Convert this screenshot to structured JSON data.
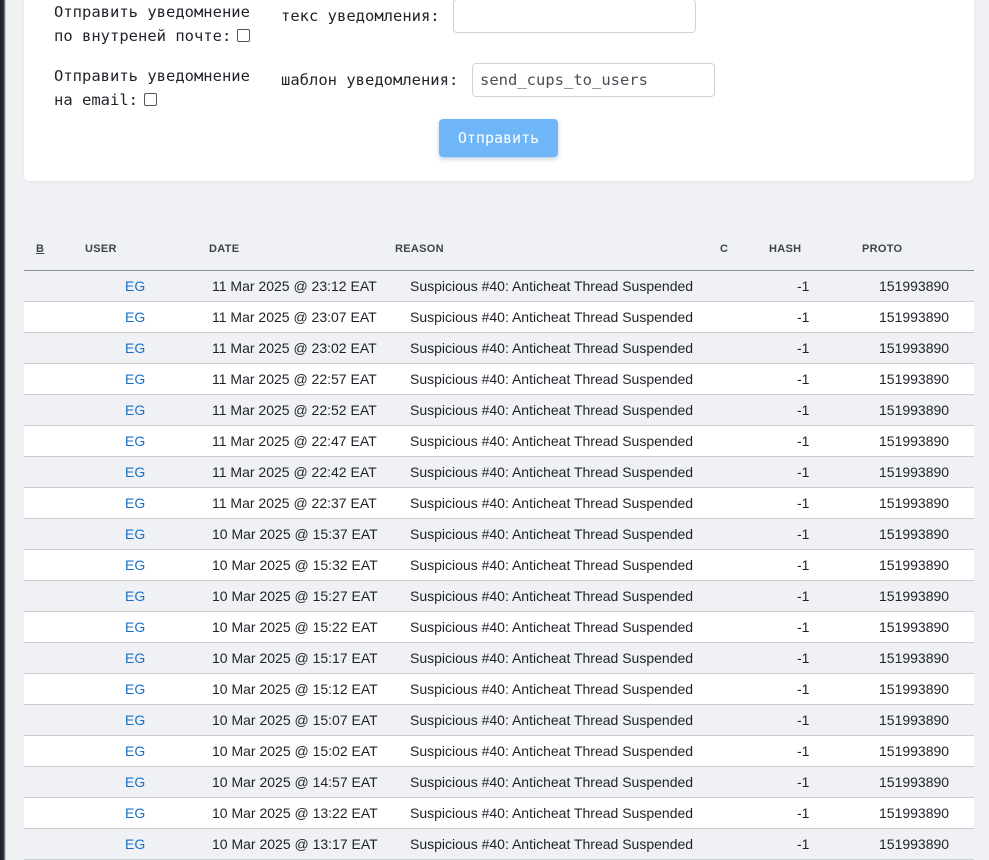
{
  "form": {
    "internal_mail_label_line1": "Отправить уведомнение",
    "internal_mail_label_line2": "по внутреней почте:",
    "email_label_line1": "Отправить уведомнение",
    "email_label_line2": "на email:",
    "text_label": "текс уведомления:",
    "text_value": "",
    "template_label": "шаблон уведомления:",
    "template_value": "send_cups_to_users",
    "send_button": "Отправить",
    "button_color": "#6eb6f7"
  },
  "table": {
    "headers": [
      "B",
      "USER",
      "DATE",
      "REASON",
      "C",
      "HASH",
      "PROTO"
    ],
    "rows": [
      {
        "user": "EG",
        "date": "11 Mar 2025 @ 23:12 EAT",
        "reason": "Suspicious #40: Anticheat Thread Suspended",
        "hash": "-1",
        "proto": "151993890"
      },
      {
        "user": "EG",
        "date": "11 Mar 2025 @ 23:07 EAT",
        "reason": "Suspicious #40: Anticheat Thread Suspended",
        "hash": "-1",
        "proto": "151993890"
      },
      {
        "user": "EG",
        "date": "11 Mar 2025 @ 23:02 EAT",
        "reason": "Suspicious #40: Anticheat Thread Suspended",
        "hash": "-1",
        "proto": "151993890"
      },
      {
        "user": "EG",
        "date": "11 Mar 2025 @ 22:57 EAT",
        "reason": "Suspicious #40: Anticheat Thread Suspended",
        "hash": "-1",
        "proto": "151993890"
      },
      {
        "user": "EG",
        "date": "11 Mar 2025 @ 22:52 EAT",
        "reason": "Suspicious #40: Anticheat Thread Suspended",
        "hash": "-1",
        "proto": "151993890"
      },
      {
        "user": "EG",
        "date": "11 Mar 2025 @ 22:47 EAT",
        "reason": "Suspicious #40: Anticheat Thread Suspended",
        "hash": "-1",
        "proto": "151993890"
      },
      {
        "user": "EG",
        "date": "11 Mar 2025 @ 22:42 EAT",
        "reason": "Suspicious #40: Anticheat Thread Suspended",
        "hash": "-1",
        "proto": "151993890"
      },
      {
        "user": "EG",
        "date": "11 Mar 2025 @ 22:37 EAT",
        "reason": "Suspicious #40: Anticheat Thread Suspended",
        "hash": "-1",
        "proto": "151993890"
      },
      {
        "user": "EG",
        "date": "10 Mar 2025 @ 15:37 EAT",
        "reason": "Suspicious #40: Anticheat Thread Suspended",
        "hash": "-1",
        "proto": "151993890"
      },
      {
        "user": "EG",
        "date": "10 Mar 2025 @ 15:32 EAT",
        "reason": "Suspicious #40: Anticheat Thread Suspended",
        "hash": "-1",
        "proto": "151993890"
      },
      {
        "user": "EG",
        "date": "10 Mar 2025 @ 15:27 EAT",
        "reason": "Suspicious #40: Anticheat Thread Suspended",
        "hash": "-1",
        "proto": "151993890"
      },
      {
        "user": "EG",
        "date": "10 Mar 2025 @ 15:22 EAT",
        "reason": "Suspicious #40: Anticheat Thread Suspended",
        "hash": "-1",
        "proto": "151993890"
      },
      {
        "user": "EG",
        "date": "10 Mar 2025 @ 15:17 EAT",
        "reason": "Suspicious #40: Anticheat Thread Suspended",
        "hash": "-1",
        "proto": "151993890"
      },
      {
        "user": "EG",
        "date": "10 Mar 2025 @ 15:12 EAT",
        "reason": "Suspicious #40: Anticheat Thread Suspended",
        "hash": "-1",
        "proto": "151993890"
      },
      {
        "user": "EG",
        "date": "10 Mar 2025 @ 15:07 EAT",
        "reason": "Suspicious #40: Anticheat Thread Suspended",
        "hash": "-1",
        "proto": "151993890"
      },
      {
        "user": "EG",
        "date": "10 Mar 2025 @ 15:02 EAT",
        "reason": "Suspicious #40: Anticheat Thread Suspended",
        "hash": "-1",
        "proto": "151993890"
      },
      {
        "user": "EG",
        "date": "10 Mar 2025 @ 14:57 EAT",
        "reason": "Suspicious #40: Anticheat Thread Suspended",
        "hash": "-1",
        "proto": "151993890"
      },
      {
        "user": "EG",
        "date": "10 Mar 2025 @ 13:22 EAT",
        "reason": "Suspicious #40: Anticheat Thread Suspended",
        "hash": "-1",
        "proto": "151993890"
      },
      {
        "user": "EG",
        "date": "10 Mar 2025 @ 13:17 EAT",
        "reason": "Suspicious #40: Anticheat Thread Suspended",
        "hash": "-1",
        "proto": "151993890"
      }
    ]
  }
}
